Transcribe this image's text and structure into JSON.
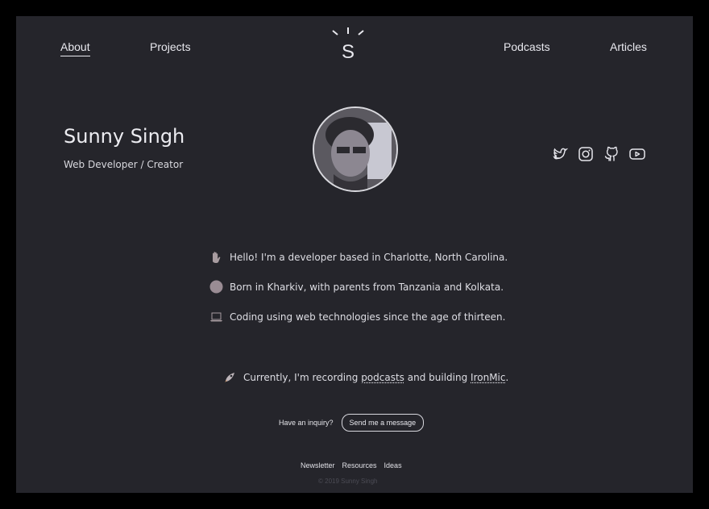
{
  "nav": {
    "about": "About",
    "projects": "Projects",
    "podcasts": "Podcasts",
    "articles": "Articles",
    "logo_letter": "S"
  },
  "profile": {
    "name": "Sunny Singh",
    "role": "Web Developer / Creator"
  },
  "social": [
    "twitter-icon",
    "instagram-icon",
    "github-icon",
    "youtube-icon"
  ],
  "bio": {
    "line1": "Hello! I'm a developer based in Charlotte, North Carolina.",
    "line2": "Born in Kharkiv, with parents from Tanzania and Kolkata.",
    "line3": "Coding using web technologies since the age of thirteen."
  },
  "current": {
    "prefix": "Currently, I'm recording ",
    "podcasts_link": "podcasts",
    "middle": " and building ",
    "ironmic_link": "IronMic",
    "suffix": "."
  },
  "inquiry": {
    "label": "Have an inquiry?",
    "button": "Send me a message"
  },
  "footer": {
    "newsletter": "Newsletter",
    "resources": "Resources",
    "ideas": "Ideas",
    "copyright": "© 2019 Sunny Singh"
  }
}
